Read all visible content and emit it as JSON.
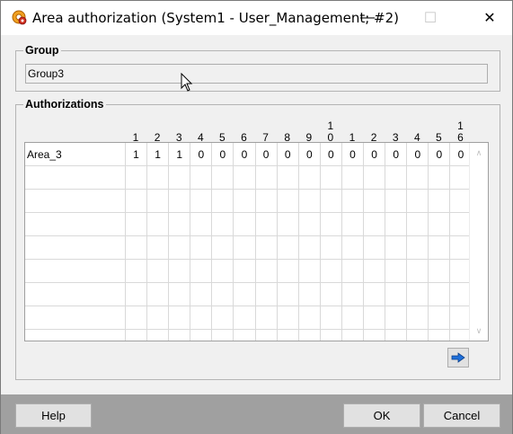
{
  "window": {
    "title": "Area authorization (System1 - User_Management; #2)",
    "controls": {
      "minimize": "—",
      "maximize": "☐",
      "close": "✕"
    }
  },
  "group": {
    "legend": "Group",
    "value": "Group3"
  },
  "authorizations": {
    "legend": "Authorizations",
    "columns": [
      {
        "top": "",
        "bottom": "1"
      },
      {
        "top": "",
        "bottom": "2"
      },
      {
        "top": "",
        "bottom": "3"
      },
      {
        "top": "",
        "bottom": "4"
      },
      {
        "top": "",
        "bottom": "5"
      },
      {
        "top": "",
        "bottom": "6"
      },
      {
        "top": "",
        "bottom": "7"
      },
      {
        "top": "",
        "bottom": "8"
      },
      {
        "top": "",
        "bottom": "9"
      },
      {
        "top": "1",
        "bottom": "0"
      },
      {
        "top": "",
        "bottom": "1"
      },
      {
        "top": "",
        "bottom": "2"
      },
      {
        "top": "",
        "bottom": "3"
      },
      {
        "top": "",
        "bottom": "4"
      },
      {
        "top": "",
        "bottom": "5"
      },
      {
        "top": "1",
        "bottom": "6"
      }
    ],
    "rows": [
      {
        "name": "Area_3",
        "values": [
          "1",
          "1",
          "1",
          "0",
          "0",
          "0",
          "0",
          "0",
          "0",
          "0",
          "0",
          "0",
          "0",
          "0",
          "0",
          "0"
        ]
      },
      {
        "name": "",
        "values": [
          "",
          "",
          "",
          "",
          "",
          "",
          "",
          "",
          "",
          "",
          "",
          "",
          "",
          "",
          "",
          ""
        ]
      },
      {
        "name": "",
        "values": [
          "",
          "",
          "",
          "",
          "",
          "",
          "",
          "",
          "",
          "",
          "",
          "",
          "",
          "",
          "",
          ""
        ]
      },
      {
        "name": "",
        "values": [
          "",
          "",
          "",
          "",
          "",
          "",
          "",
          "",
          "",
          "",
          "",
          "",
          "",
          "",
          "",
          ""
        ]
      },
      {
        "name": "",
        "values": [
          "",
          "",
          "",
          "",
          "",
          "",
          "",
          "",
          "",
          "",
          "",
          "",
          "",
          "",
          "",
          ""
        ]
      },
      {
        "name": "",
        "values": [
          "",
          "",
          "",
          "",
          "",
          "",
          "",
          "",
          "",
          "",
          "",
          "",
          "",
          "",
          "",
          ""
        ]
      },
      {
        "name": "",
        "values": [
          "",
          "",
          "",
          "",
          "",
          "",
          "",
          "",
          "",
          "",
          "",
          "",
          "",
          "",
          "",
          ""
        ]
      },
      {
        "name": "",
        "values": [
          "",
          "",
          "",
          "",
          "",
          "",
          "",
          "",
          "",
          "",
          "",
          "",
          "",
          "",
          "",
          ""
        ]
      },
      {
        "name": "",
        "values": [
          "",
          "",
          "",
          "",
          "",
          "",
          "",
          "",
          "",
          "",
          "",
          "",
          "",
          "",
          "",
          ""
        ]
      }
    ],
    "scroll_up": "∧",
    "scroll_down": "∨",
    "next_icon": "arrow-right-icon"
  },
  "footer": {
    "help_label": "Help",
    "ok_label": "OK",
    "cancel_label": "Cancel"
  },
  "colors": {
    "footer_bg": "#a0a0a0",
    "arrow_blue": "#1e6fd9"
  }
}
